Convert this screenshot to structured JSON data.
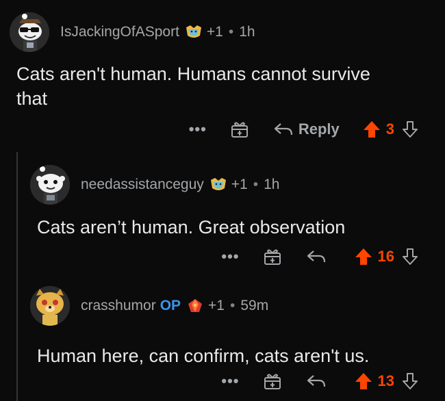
{
  "comments": [
    {
      "username": "IsJackingOfASport",
      "op_badge": "",
      "karma": "+1",
      "separator": "•",
      "time": "1h",
      "body": "Cats aren't human. Humans cannot survive that",
      "actions": {
        "more": "•••",
        "reply": "Reply",
        "score": "3"
      }
    },
    {
      "username": "needassistanceguy",
      "op_badge": "",
      "karma": "+1",
      "separator": "•",
      "time": "1h",
      "body": "Cats aren’t human. Great observation",
      "actions": {
        "more": "•••",
        "reply": "",
        "score": "16"
      }
    },
    {
      "username": "crasshumor",
      "op_badge": "OP",
      "karma": "+1",
      "separator": "•",
      "time": "59m",
      "body": "Human here, can confirm, cats aren't us.",
      "actions": {
        "more": "•••",
        "reply": "",
        "score": "13"
      }
    }
  ],
  "colors": {
    "background": "#0b0b0b",
    "upvote_active": "#ff4500",
    "op_badge": "#3a93f0",
    "muted_text": "#a4a7aa"
  },
  "icons": {
    "flair_1": "smiling-cat-flair-icon",
    "flair_2": "smiling-cat-flair-icon",
    "flair_3": "red-gem-flair-icon",
    "gift": "gift-icon",
    "reply": "reply-arrow-icon",
    "upvote": "upvote-arrow-icon",
    "downvote": "downvote-arrow-icon"
  }
}
